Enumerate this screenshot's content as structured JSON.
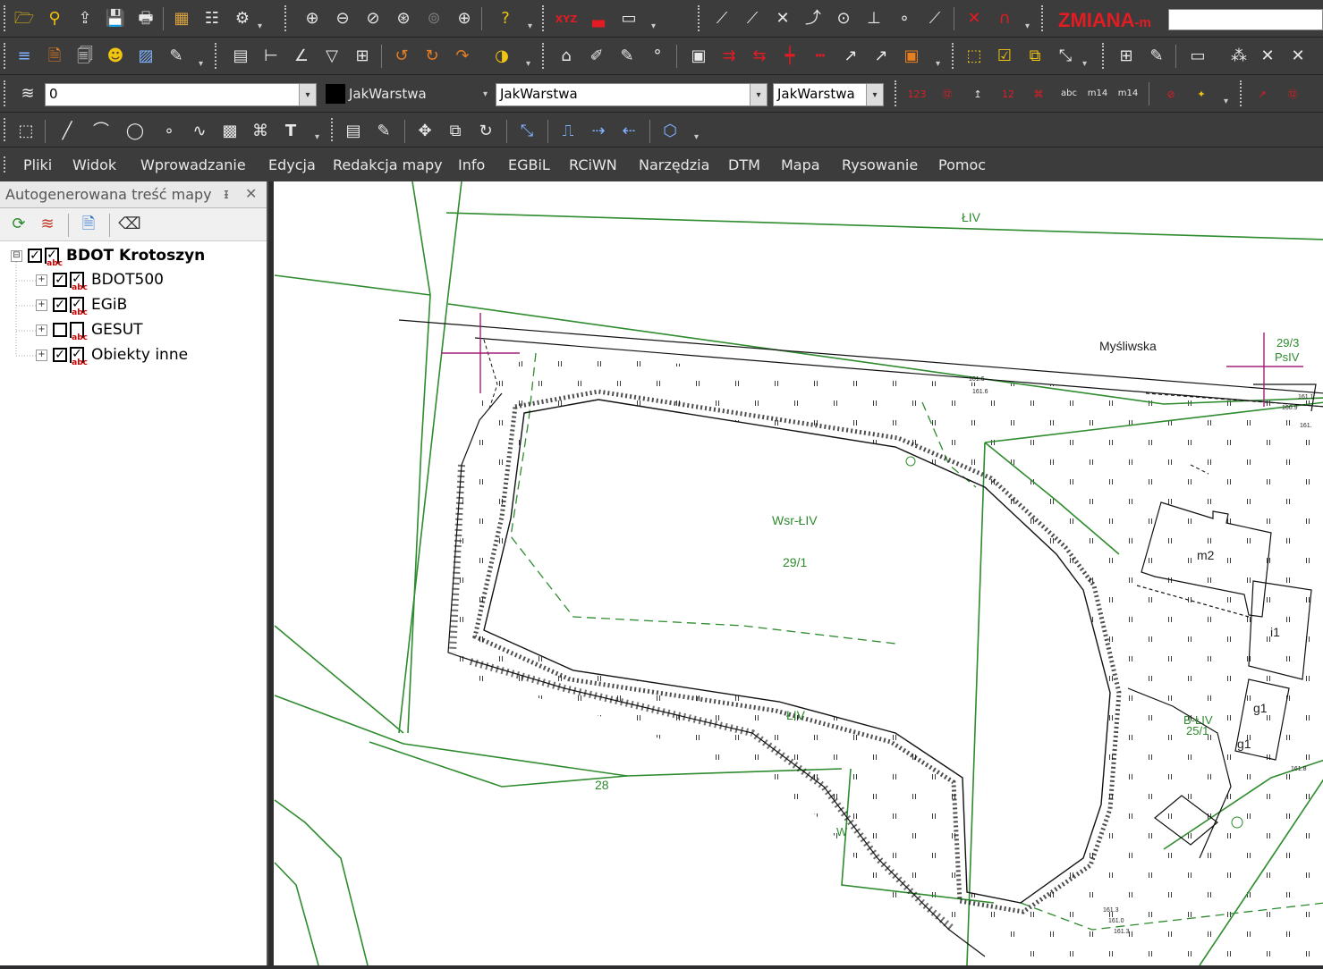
{
  "app": {
    "brand": "ZMIANA",
    "brand_suffix": "-m"
  },
  "property_bar": {
    "layer_value": "0",
    "color_label": "JakWarstwa",
    "linetype_value": "JakWarstwa",
    "lineweight_value": "JakWarstwa"
  },
  "menu": [
    "Pliki",
    "Widok",
    "Wprowadzanie",
    "Edycja",
    "Redakcja mapy",
    "Info",
    "EGBiL",
    "RCiWN",
    "Narzędzia",
    "DTM",
    "Mapa",
    "Rysowanie",
    "Pomoc"
  ],
  "panel": {
    "title": "Autogenerowana treść mapy",
    "pin": "ᵻ",
    "close": "✕",
    "root": {
      "label": "BDOT Krotoszyn",
      "checked": true,
      "expand": "⊟"
    },
    "items": [
      {
        "label": "BDOT500",
        "checked": true
      },
      {
        "label": "EGiB",
        "checked": true
      },
      {
        "label": "GESUT",
        "checked": false
      },
      {
        "label": "Obiekty inne",
        "checked": true
      }
    ],
    "expand_symbol": "+",
    "check_symbol": "✓",
    "label_badge": "abc"
  },
  "map": {
    "labels": {
      "liv_top": "ŁIV",
      "street": "Myśliwska",
      "parcel_29_3": "29/3",
      "psiv": "PsIV",
      "wsr": "Wsr-ŁIV",
      "parcel_29_1": "29/1",
      "m2": "m2",
      "i1": "i1",
      "g1a": "g1",
      "g1b": "g1",
      "bliv": "B-ŁIV",
      "parcel_25_1": "25/1",
      "liv_mid": "ŁIV",
      "parcel_28": "28",
      "w": "W",
      "h1": "161.6",
      "h2": "161.6",
      "h3": "161.1",
      "h4": "160.9",
      "h5": "161.",
      "h6": "161.3",
      "h7": "161.0",
      "h8": "161.3",
      "h9": "161.8"
    }
  },
  "colors": {
    "parcel_line": "#2e8b2e",
    "crosshair": "#a0207a",
    "toolbar_bg": "#3c3c3c"
  }
}
